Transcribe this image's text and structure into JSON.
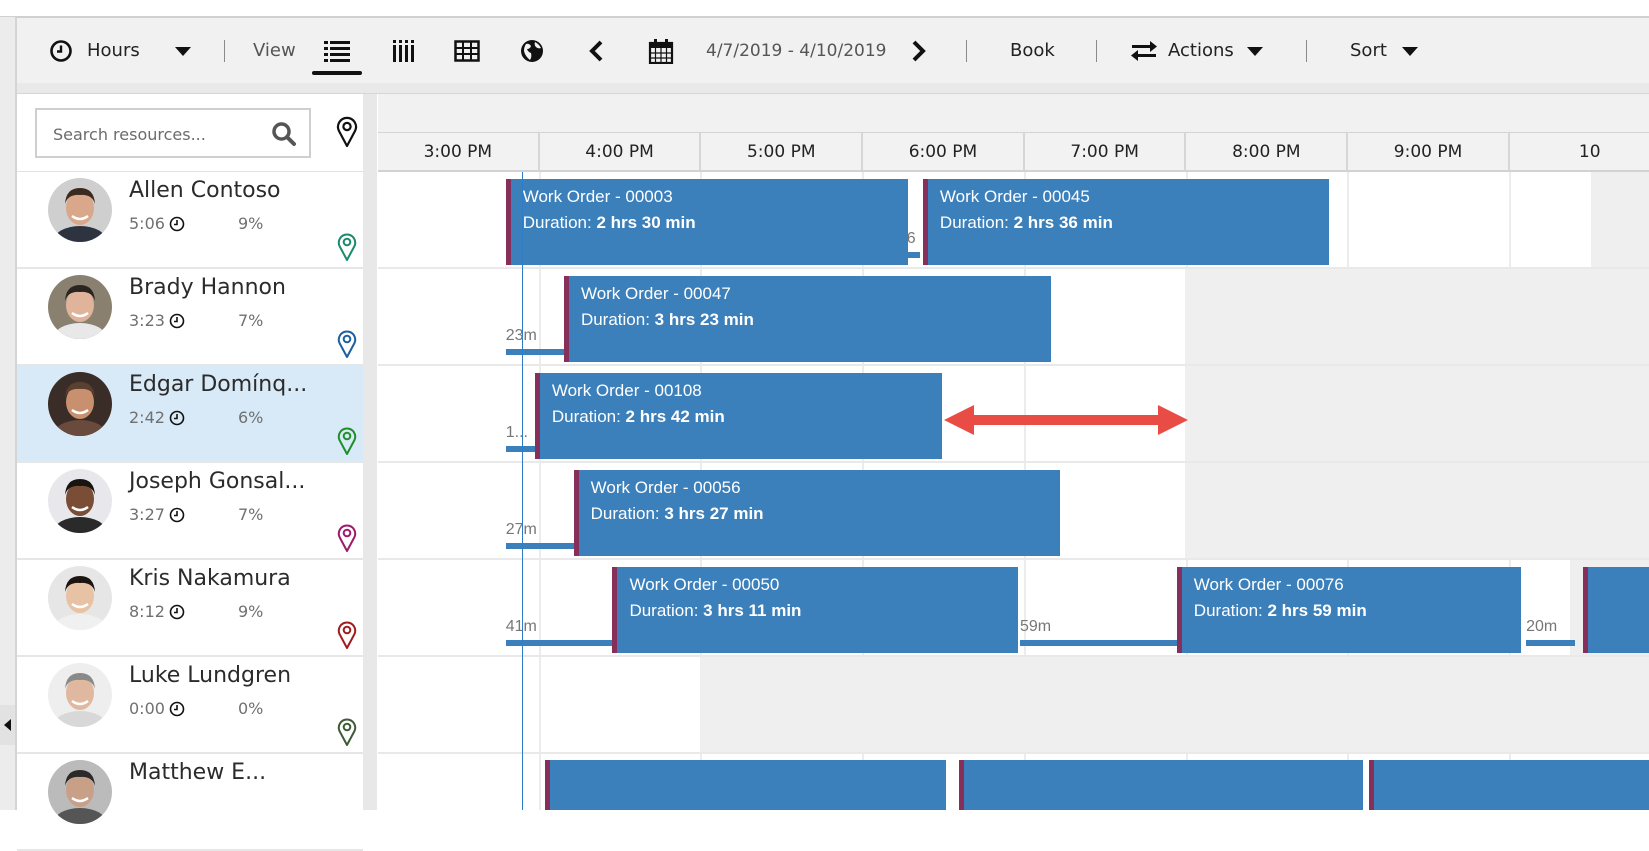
{
  "toolbar": {
    "hours_label": "Hours",
    "view_label": "View",
    "date_range": "4/7/2019 - 4/10/2019",
    "book_label": "Book",
    "actions_label": "Actions",
    "sort_label": "Sort",
    "icons": {
      "clock": "clock-icon",
      "list_view": "list-view-icon",
      "vertical_view": "vertical-view-icon",
      "grid_view": "grid-view-icon",
      "map_view": "globe-icon",
      "prev": "chevron-left-icon",
      "calendar": "calendar-icon",
      "next": "chevron-right-icon",
      "actions": "swap-arrows-icon"
    }
  },
  "search": {
    "placeholder": "Search resources...",
    "value": ""
  },
  "colors": {
    "booking": "#3c80bb",
    "booking_accent": "#862f5b",
    "selected_row": "#d8e9f7",
    "now_line": "#2c7cc7",
    "arrow": "#e84c45"
  },
  "timeline": {
    "hours": [
      "3:00 PM",
      "4:00 PM",
      "5:00 PM",
      "6:00 PM",
      "7:00 PM",
      "8:00 PM",
      "9:00 PM",
      "10"
    ]
  },
  "resources": [
    {
      "name": "Allen Contoso",
      "hours": "5:06",
      "percent": "9%",
      "pin_color": "#1a8a6e",
      "selected": false,
      "bookings": [
        {
          "title": "Work Order - 00003",
          "duration_label": "Duration: ",
          "duration": "2 hrs 30 min"
        },
        {
          "title": "Work Order - 00045",
          "duration_label": "Duration: ",
          "duration": "2 hrs 36 min"
        }
      ],
      "travel_labels": [
        "6"
      ]
    },
    {
      "name": "Brady Hannon",
      "hours": "3:23",
      "percent": "7%",
      "pin_color": "#1c5fa0",
      "selected": false,
      "bookings": [
        {
          "title": "Work Order - 00047",
          "duration_label": "Duration: ",
          "duration": "3 hrs 23 min"
        }
      ],
      "travel_labels": [
        "23m"
      ]
    },
    {
      "name": "Edgar Domínq...",
      "hours": "2:42",
      "percent": "6%",
      "pin_color": "#1e8f2a",
      "selected": true,
      "bookings": [
        {
          "title": "Work Order - 00108",
          "duration_label": "Duration: ",
          "duration": "2 hrs 42 min"
        }
      ],
      "travel_labels": [
        "1..."
      ]
    },
    {
      "name": "Joseph Gonsal...",
      "hours": "3:27",
      "percent": "7%",
      "pin_color": "#a0186e",
      "selected": false,
      "bookings": [
        {
          "title": "Work Order - 00056",
          "duration_label": "Duration: ",
          "duration": "3 hrs 27 min"
        }
      ],
      "travel_labels": [
        "27m"
      ]
    },
    {
      "name": "Kris Nakamura",
      "hours": "8:12",
      "percent": "9%",
      "pin_color": "#a01c1c",
      "selected": false,
      "bookings": [
        {
          "title": "Work Order - 00050",
          "duration_label": "Duration: ",
          "duration": "3 hrs 11 min"
        },
        {
          "title": "Work Order - 00076",
          "duration_label": "Duration: ",
          "duration": "2 hrs 59 min"
        }
      ],
      "travel_labels": [
        "41m",
        "59m",
        "20m"
      ]
    },
    {
      "name": "Luke Lundgren",
      "hours": "0:00",
      "percent": "0%",
      "pin_color": "#3f5a34",
      "selected": false,
      "bookings": [],
      "travel_labels": []
    },
    {
      "name": "Matthew E...",
      "hours": "",
      "percent": "",
      "pin_color": "",
      "selected": false,
      "bookings": [],
      "travel_labels": []
    }
  ]
}
